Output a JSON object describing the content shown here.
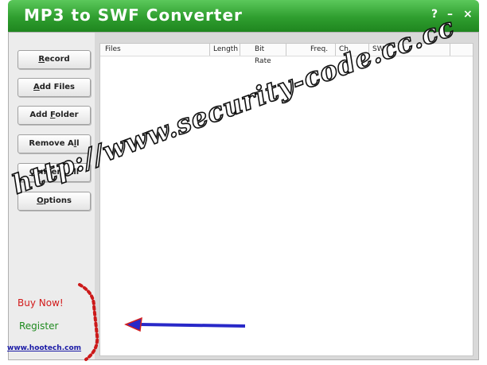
{
  "window": {
    "title": "MP3 to SWF Converter",
    "help": "?",
    "minimize": "–",
    "close": "×"
  },
  "sidebar": {
    "buttons": [
      {
        "pre": "",
        "key": "R",
        "post": "ecord"
      },
      {
        "pre": "",
        "key": "A",
        "post": "dd Files"
      },
      {
        "pre": "Add ",
        "key": "F",
        "post": "older"
      },
      {
        "pre": "Remove A",
        "key": "l",
        "post": "l"
      },
      {
        "pre": "",
        "key": "C",
        "post": "onvert All"
      },
      {
        "pre": "",
        "key": "O",
        "post": "ptions"
      }
    ],
    "buy_now": "Buy Now!",
    "register": "Register",
    "website": "www.hootech.com"
  },
  "list": {
    "columns": [
      "Files",
      "Length",
      "Bit Rate",
      "Freq.",
      "Ch.",
      "SWF"
    ]
  },
  "annotations": {
    "watermark": "http://www.security-code.cc.cc",
    "arrow_color": "#2828c8",
    "arrow_outline": "#d42020",
    "bracket_color": "#cc1a1a"
  }
}
